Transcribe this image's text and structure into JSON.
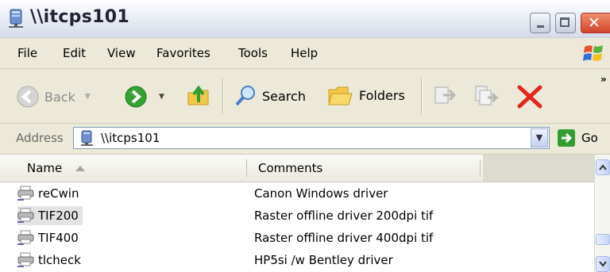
{
  "window": {
    "title": "\\\\itcps101",
    "icon": "network-computer-icon"
  },
  "menu": {
    "items": [
      "File",
      "Edit",
      "View",
      "Favorites",
      "Tools",
      "Help"
    ]
  },
  "toolbar": {
    "back_label": "Back",
    "search_label": "Search",
    "folders_label": "Folders",
    "more_chevron": "»"
  },
  "address": {
    "label": "Address",
    "value": "\\\\itcps101",
    "go_label": "Go"
  },
  "list": {
    "columns": [
      "Name",
      "Comments"
    ],
    "sort_column": "Name",
    "rows": [
      {
        "name": "reCwin",
        "comment": "Canon Windows driver",
        "selected": false
      },
      {
        "name": "TIF200",
        "comment": "Raster offline driver 200dpi tif",
        "selected": true
      },
      {
        "name": "TIF400",
        "comment": "Raster offline driver 400dpi tif",
        "selected": false
      },
      {
        "name": "tlcheck",
        "comment": "HP5si /w Bentley driver",
        "selected": false
      }
    ]
  },
  "colors": {
    "chrome": "#ece9d8",
    "go_green": "#2f9e2f",
    "delete_red": "#e0281e",
    "selection": "#e3e3e3"
  }
}
